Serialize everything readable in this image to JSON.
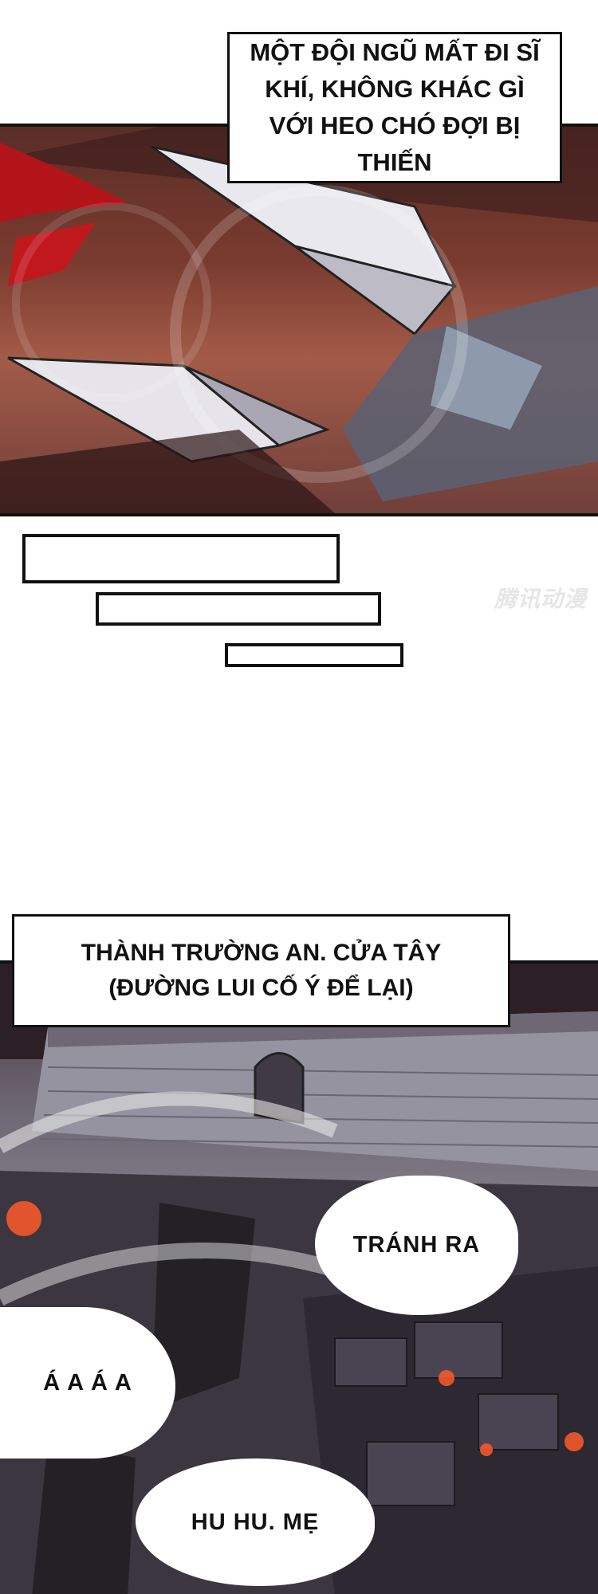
{
  "captions": {
    "top": "MỘT ĐỘI NGŨ MẤT ĐI SĨ KHÍ, KHÔNG KHÁC GÌ VỚI HEO CHÓ ĐỢI BỊ THIẾN",
    "location": "THÀNH TRƯỜNG AN. CỬA TÂY (ĐƯỜNG LUI CỐ Ý ĐỂ LẠI)"
  },
  "watermark": "腾讯动漫",
  "bubbles": {
    "tranh_ra": "TRÁNH RA",
    "aaaa": "Á A Á A",
    "hu_hu": "HU HU. MẸ"
  },
  "colors": {
    "panel1_blood": "#b3141a",
    "panel2_fire": "#ff5a2b"
  }
}
